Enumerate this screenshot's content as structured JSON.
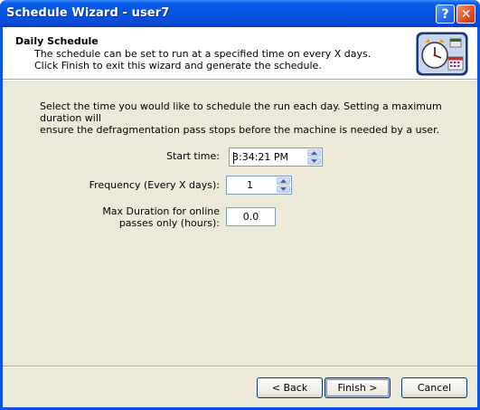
{
  "window": {
    "title": "Schedule Wizard - user7",
    "help_glyph": "?",
    "close_glyph": "✕"
  },
  "header": {
    "title": "Daily Schedule",
    "description_line1": "The schedule can be set to run at a specified time on every X days.",
    "description_line2": "Click Finish to exit this wizard and generate the schedule.",
    "icon": "clock-calendar-icon"
  },
  "intro_line1": "Select the time you would like to schedule the run each day.  Setting a maximum duration will",
  "intro_line2": "ensure the defragmentation pass stops before the machine is needed by a user.",
  "form": {
    "start_time_label": "Start time:",
    "start_time_value": "3:34:21 PM",
    "frequency_label": "Frequency (Every X days):",
    "frequency_value": "1",
    "max_duration_label_line1": "Max Duration for online",
    "max_duration_label_line2": "passes only (hours):",
    "max_duration_value": "0.0"
  },
  "buttons": {
    "back": "< Back",
    "finish": "Finish >",
    "cancel": "Cancel"
  },
  "colors": {
    "titlebar": "#0a5ee8",
    "dialog_bg": "#ece9d8",
    "field_border": "#7f9db9",
    "close_button": "#e0532d"
  }
}
